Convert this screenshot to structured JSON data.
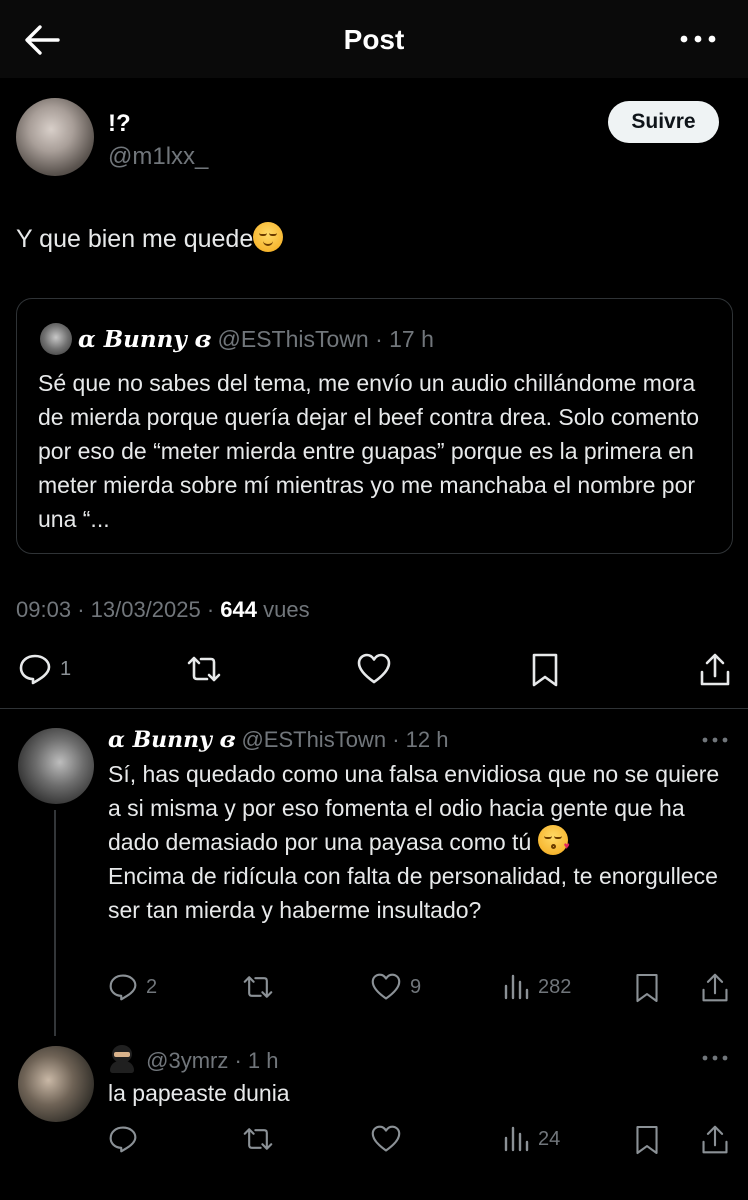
{
  "header": {
    "title": "Post"
  },
  "post": {
    "author_name": "!?",
    "author_handle": "@m1lxx_",
    "follow_label": "Suivre",
    "text": "Y que bien me quede",
    "quote": {
      "name": "ɑ 𝑩𝒖𝒏𝒏𝒚 ɞ",
      "handle": "@ESThisTown",
      "time": "· 17 h",
      "text": "Sé que no sabes del tema, me envío un audio chillándome mora de mierda porque quería dejar el beef contra drea. Solo comento por eso de “meter mierda entre guapas” porque es la primera en meter mierda sobre mí mientras yo me manchaba el nombre por una “..."
    },
    "meta": {
      "time": "09:03",
      "date": "· 13/03/2025 ·",
      "views": "644",
      "views_label": "vues"
    },
    "actions": {
      "replies": "1"
    }
  },
  "replies": [
    {
      "name": "ɑ 𝑩𝒖𝒏𝒏𝒚 ɞ",
      "handle": "@ESThisTown",
      "time": "· 12 h",
      "line1": "Sí, has quedado como una falsa envidiosa que no se quiere a si misma y por eso fomenta el odio hacia gente que ha dado demasiado por una payasa como tú",
      "line2": "Encima de ridícula con falta de personalidad, te enorgullece ser tan mierda y haberme insultado?",
      "replies": "2",
      "likes": "9",
      "views": "282"
    },
    {
      "handle": "@3ymrz",
      "time": "· 1 h",
      "text": "la papeaste dunia",
      "views": "24"
    }
  ],
  "icons": [
    "back-arrow-icon",
    "more-icon",
    "reply-icon",
    "retweet-icon",
    "like-icon",
    "bookmark-icon",
    "share-icon",
    "views-icon",
    "ninja-emoji-icon"
  ],
  "colors": {
    "background": "#000000",
    "text": "#e7e9ea",
    "muted": "#71767b",
    "divider": "#2f3336",
    "button": "#eff3f4"
  }
}
